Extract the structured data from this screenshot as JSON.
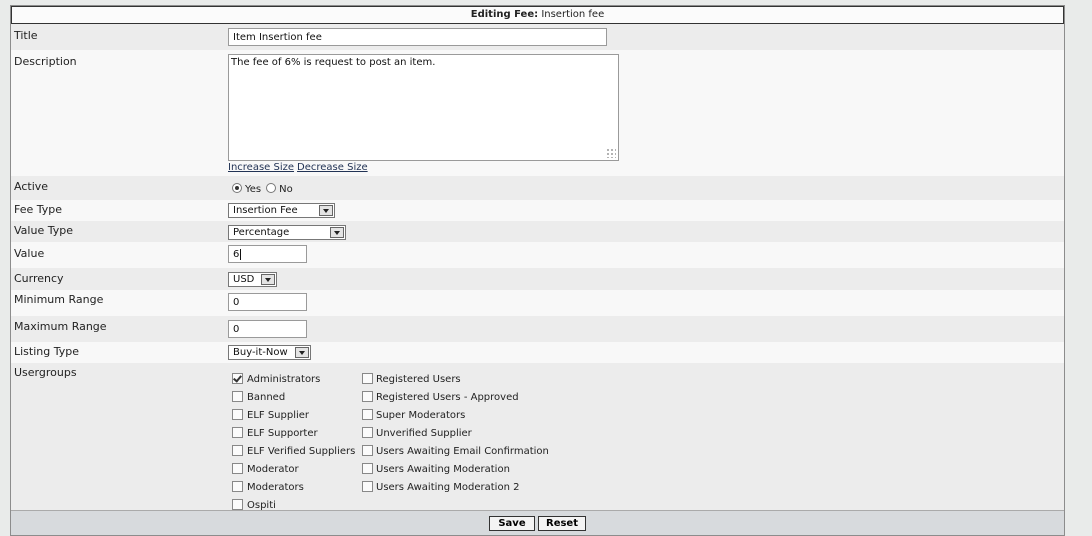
{
  "header": {
    "prefix": "Editing Fee:",
    "name": "Insertion fee"
  },
  "fields": {
    "title": {
      "label": "Title",
      "value": "Item Insertion fee"
    },
    "description": {
      "label": "Description",
      "value": "The fee of 6% is request to post an item.",
      "increase_link": "Increase Size",
      "decrease_link": "Decrease Size"
    },
    "active": {
      "label": "Active",
      "yes": "Yes",
      "no": "No",
      "selected": "Yes"
    },
    "fee_type": {
      "label": "Fee Type",
      "value": "Insertion Fee"
    },
    "value_type": {
      "label": "Value Type",
      "value": "Percentage"
    },
    "value": {
      "label": "Value",
      "value": "6"
    },
    "currency": {
      "label": "Currency",
      "value": "USD"
    },
    "min_range": {
      "label": "Minimum Range",
      "value": "0"
    },
    "max_range": {
      "label": "Maximum Range",
      "value": "0"
    },
    "listing_type": {
      "label": "Listing Type",
      "value": "Buy-it-Now"
    },
    "usergroups": {
      "label": "Usergroups",
      "left": [
        {
          "name": "Administrators",
          "checked": true
        },
        {
          "name": "Banned",
          "checked": false
        },
        {
          "name": "ELF Supplier",
          "checked": false
        },
        {
          "name": "ELF Supporter",
          "checked": false
        },
        {
          "name": "ELF Verified Suppliers",
          "checked": false
        },
        {
          "name": "Moderator",
          "checked": false
        },
        {
          "name": "Moderators",
          "checked": false
        },
        {
          "name": "Ospiti",
          "checked": false
        }
      ],
      "right": [
        {
          "name": "Registered Users",
          "checked": false
        },
        {
          "name": "Registered Users - Approved",
          "checked": false
        },
        {
          "name": "Super Moderators",
          "checked": false
        },
        {
          "name": "Unverified Supplier",
          "checked": false
        },
        {
          "name": "Users Awaiting Email Confirmation",
          "checked": false
        },
        {
          "name": "Users Awaiting Moderation",
          "checked": false
        },
        {
          "name": "Users Awaiting Moderation 2",
          "checked": false
        }
      ]
    }
  },
  "buttons": {
    "save": "Save",
    "reset": "Reset"
  }
}
